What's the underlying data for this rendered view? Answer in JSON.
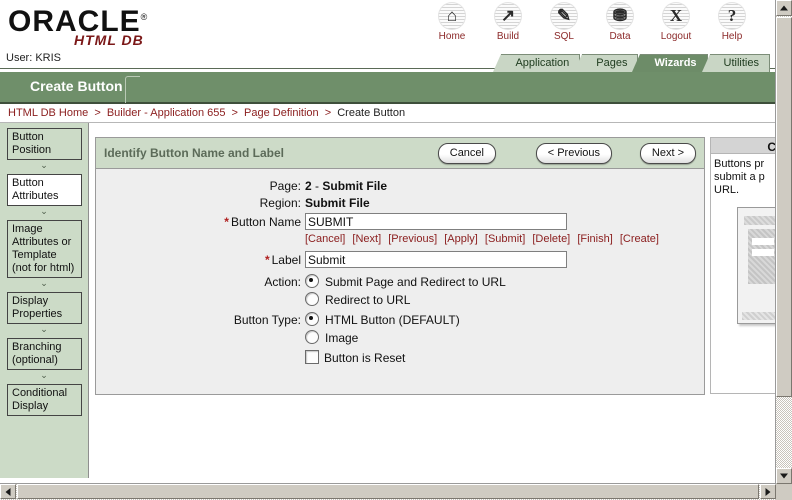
{
  "brand": {
    "name": "ORACLE",
    "registered": "®",
    "product": "HTML DB"
  },
  "user": {
    "label": "User: KRIS"
  },
  "icon_nav": [
    {
      "label": "Home",
      "icon": "home-icon",
      "glyph": "⌂"
    },
    {
      "label": "Build",
      "icon": "build-icon",
      "glyph": "↗"
    },
    {
      "label": "SQL",
      "icon": "sql-icon",
      "glyph": "✎"
    },
    {
      "label": "Data",
      "icon": "data-icon",
      "glyph": "⛃"
    },
    {
      "label": "Logout",
      "icon": "logout-icon",
      "glyph": "X"
    },
    {
      "label": "Help",
      "icon": "help-icon",
      "glyph": "?"
    }
  ],
  "tabs": [
    {
      "label": "Application",
      "active": false
    },
    {
      "label": "Pages",
      "active": false
    },
    {
      "label": "Wizards",
      "active": true
    },
    {
      "label": "Utilities",
      "active": false
    }
  ],
  "page_title": "Create Button",
  "breadcrumb": {
    "items": [
      {
        "label": "HTML DB Home",
        "current": false
      },
      {
        "label": "Builder - Application 655",
        "current": false
      },
      {
        "label": "Page Definition",
        "current": false
      },
      {
        "label": "Create Button",
        "current": true
      }
    ],
    "separator": ">"
  },
  "sidebar": {
    "items": [
      {
        "label": "Button Position",
        "selected": false
      },
      {
        "label": "Button Attributes",
        "selected": true
      },
      {
        "label": "Image Attributes or Template (not for html)",
        "selected": false
      },
      {
        "label": "Display Properties",
        "selected": false
      },
      {
        "label": "Branching (optional)",
        "selected": false
      },
      {
        "label": "Conditional Display",
        "selected": false
      }
    ],
    "arrow": "⌄"
  },
  "main": {
    "header": {
      "title": "Identify Button Name and Label",
      "cancel_label": "Cancel",
      "previous_label": "< Previous",
      "next_label": "Next >"
    },
    "fields": {
      "page_label": "Page:",
      "page_number": "2",
      "page_sep": " - ",
      "page_name": "Submit File",
      "region_label": "Region:",
      "region_value": "Submit File",
      "button_name_label": "Button Name",
      "button_name_value": "SUBMIT",
      "label_label": "Label",
      "label_value": "Submit",
      "required_mark": "*"
    },
    "shortcuts": [
      "[Cancel]",
      "[Next]",
      "[Previous]",
      "[Apply]",
      "[Submit]",
      "[Delete]",
      "[Finish]",
      "[Create]"
    ],
    "action": {
      "label": "Action:",
      "options": [
        {
          "label": "Submit Page and Redirect to URL",
          "selected": true
        },
        {
          "label": "Redirect to URL",
          "selected": false
        }
      ]
    },
    "button_type": {
      "label": "Button Type:",
      "options": [
        {
          "label": "HTML Button (DEFAULT)",
          "selected": true
        },
        {
          "label": "Image",
          "selected": false
        }
      ]
    },
    "reset_checkbox": {
      "label": "Button is Reset",
      "checked": false
    }
  },
  "help": {
    "title": "C",
    "text": "Buttons pr submit a p URL."
  },
  "colors": {
    "green_band": "#6f8f6a",
    "sidebar_green": "#ccdbc7",
    "panel_header_green": "#cddbc8",
    "link_red": "#8c2020",
    "active_tab": "#6d8c68",
    "panel_bg": "#eeeeee"
  },
  "scrollbars": {
    "up_arrow": "▲",
    "down_arrow": "▼",
    "left_arrow": "◀",
    "right_arrow": "▶"
  }
}
